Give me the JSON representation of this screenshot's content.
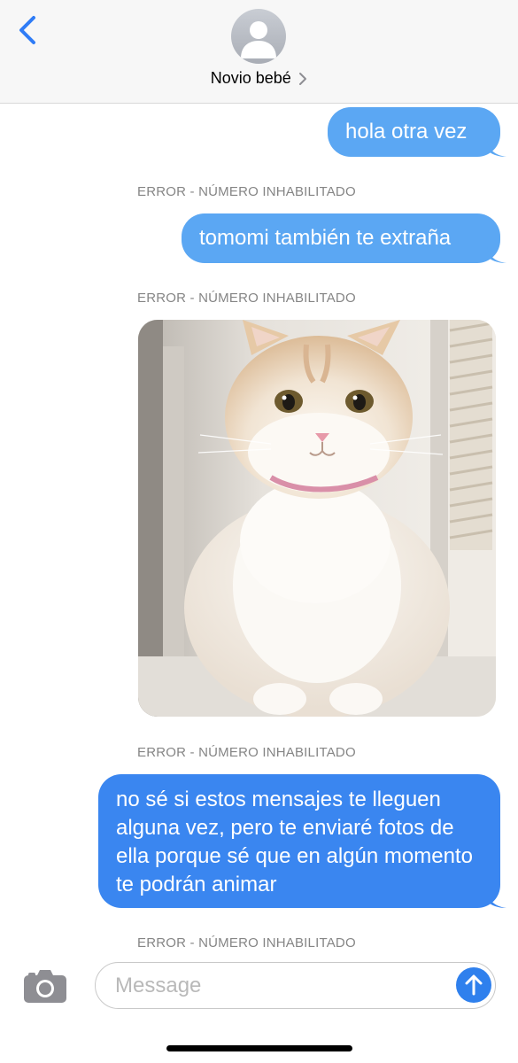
{
  "header": {
    "contact_name": "Novio bebé",
    "back_icon": "chevron-left-icon",
    "avatar_icon": "person-silhouette-icon",
    "chevron_icon": "chevron-right-icon"
  },
  "thread": {
    "messages": [
      {
        "type": "text",
        "text": "hola otra vez",
        "status": "ERROR - NÚMERO INHABILITADO"
      },
      {
        "type": "text",
        "text": "tomomi también te extraña",
        "status": "ERROR - NÚMERO INHABILITADO"
      },
      {
        "type": "image",
        "subject": "cat-photo",
        "status": "ERROR - NÚMERO INHABILITADO"
      },
      {
        "type": "text",
        "text": "no sé si estos mensajes te lleguen alguna vez, pero te enviaré fotos de ella porque sé que en algún momento te podrán animar",
        "status": "ERROR - NÚMERO INHABILITADO"
      }
    ]
  },
  "composer": {
    "placeholder": "Message",
    "camera_icon": "camera-icon",
    "send_icon": "arrow-up-icon"
  },
  "colors": {
    "bubble_light": "#5ba7f3",
    "bubble_dark": "#3a86f0",
    "status_gray": "#858585",
    "accent_blue": "#2f80ed",
    "header_bg": "#f7f7f7"
  }
}
